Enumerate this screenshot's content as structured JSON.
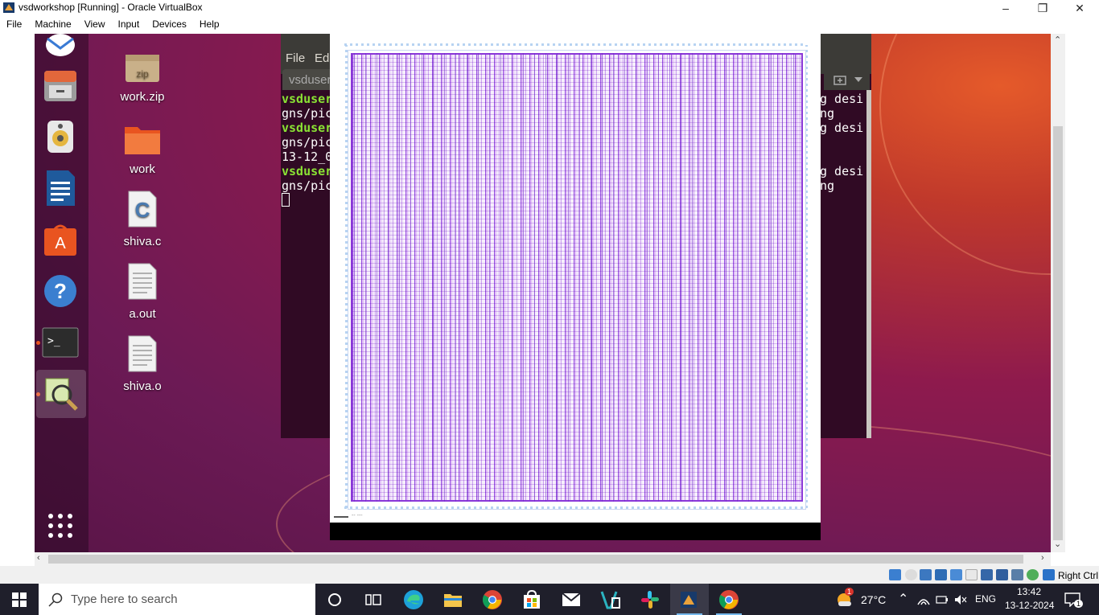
{
  "vbox": {
    "title": "vsdworkshop [Running] - Oracle VirtualBox",
    "menu": [
      "File",
      "Machine",
      "View",
      "Input",
      "Devices",
      "Help"
    ],
    "host_key": "Right Ctrl"
  },
  "desktop": {
    "icons": [
      {
        "label": "work.zip",
        "icon": "zip-archive-icon",
        "badge": "zip"
      },
      {
        "label": "work",
        "icon": "folder-icon"
      },
      {
        "label": "shiva.c",
        "icon": "c-source-file-icon"
      },
      {
        "label": "a.out",
        "icon": "text-file-icon"
      },
      {
        "label": "shiva.o",
        "icon": "text-file-icon"
      }
    ]
  },
  "dock": {
    "items": [
      "thunderbird-icon",
      "files-icon",
      "rhythmbox-icon",
      "libreoffice-writer-icon",
      "ubuntu-software-icon",
      "help-icon",
      "terminal-icon",
      "magic-layout-viewer-icon",
      "show-apps-icon"
    ]
  },
  "terminal": {
    "menu_file": "File",
    "menu_edit": "Edi",
    "tab_label": "vsduser",
    "lines_left": [
      {
        "text": "vsduser",
        "type": "prompt"
      },
      {
        "text": "gns/pic",
        "type": "out"
      },
      {
        "text": "vsduser",
        "type": "prompt"
      },
      {
        "text": "gns/pic",
        "type": "out"
      },
      {
        "text": "13-12_0",
        "type": "out"
      },
      {
        "text": "vsduser",
        "type": "prompt"
      },
      {
        "text": "gns/pic",
        "type": "out"
      }
    ],
    "lines_right": [
      "g desi",
      "ng",
      "g desi",
      "",
      "",
      "g desi",
      "ng"
    ]
  },
  "viewer": {
    "scale_label": "-- ---"
  },
  "taskbar": {
    "search_placeholder": "Type here to search",
    "weather": "27°C",
    "weather_badge": "1",
    "language": "ENG",
    "time": "13:42",
    "date": "13-12-2024",
    "notification_count": "1",
    "apps": [
      "cortana-icon",
      "task-view-icon",
      "edge-icon",
      "file-explorer-icon",
      "chrome-icon",
      "microsoft-store-icon",
      "mail-icon",
      "vs-icon",
      "slack-icon",
      "virtualbox-icon",
      "chrome-icon"
    ]
  },
  "colors": {
    "ubuntu_orange": "#e95420",
    "terminal_bg": "#300a24",
    "prompt_green": "#8ae234",
    "layout_purple": "#8a37d8",
    "taskbar_bg": "#1f1f2b"
  }
}
